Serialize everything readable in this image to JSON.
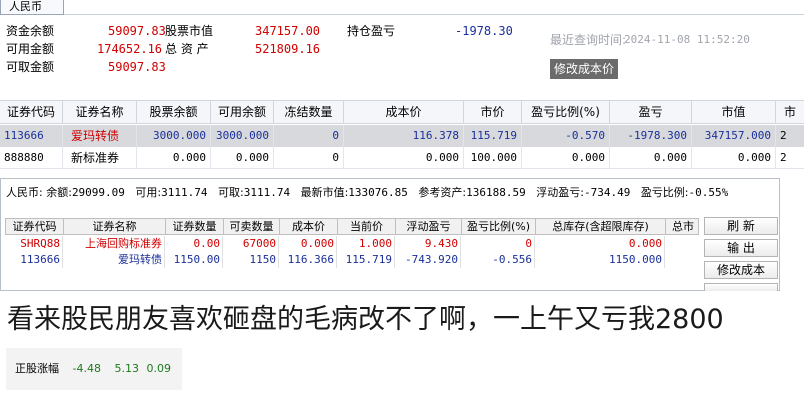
{
  "tab": {
    "label": "人民币"
  },
  "summary": {
    "cash_balance_label": "资金余额",
    "cash_balance": "59097.83",
    "available_label": "可用金额",
    "available": "174652.16",
    "withdrawable_label": "可取金额",
    "withdrawable": "59097.83",
    "stock_value_label": "股票市值",
    "stock_value": "347157.00",
    "total_assets_label": "总 资 产",
    "total_assets": "521809.16",
    "position_pl_label": "持仓盈亏",
    "position_pl": "-1978.30",
    "last_query_label": "最近查询时间:",
    "last_query_time": "2024-11-08 11:52:20",
    "modify_cost_button": "修改成本价"
  },
  "table1": {
    "headers": [
      "证券代码",
      "证券名称",
      "股票余额",
      "可用余额",
      "冻结数量",
      "成本价",
      "市价",
      "盈亏比例(%)",
      "盈亏",
      "市值",
      "市"
    ],
    "rows": [
      [
        "113666",
        "爱玛转债",
        "3000.000",
        "3000.000",
        "0",
        "116.378",
        "115.719",
        "-0.570",
        "-1978.300",
        "347157.000",
        "2"
      ],
      [
        "888880",
        "新标准券",
        "0.000",
        "0.000",
        "0",
        "0.000",
        "100.000",
        "0.000",
        "0.000",
        "0.000",
        "2"
      ]
    ]
  },
  "panel2": {
    "currency": "人民币:",
    "balance_label": "余额:",
    "balance": "29099.09",
    "available_label": "可用:",
    "available": "3111.74",
    "withdrawable_label": "可取:",
    "withdrawable": "3111.74",
    "latest_value_label": "最新市值:",
    "latest_value": "133076.85",
    "ref_assets_label": "参考资产:",
    "ref_assets": "136188.59",
    "float_pl_label": "浮动盈亏:",
    "float_pl": "-734.49",
    "pl_ratio_label": "盈亏比例:",
    "pl_ratio": "-0.55%",
    "headers": [
      "证券代码",
      "证券名称",
      "证券数量",
      "可卖数量",
      "成本价",
      "当前价",
      "浮动盈亏",
      "盈亏比例(%)",
      "总库存(含超限库存)",
      "总市"
    ],
    "rows": [
      [
        "SHRQ88",
        "上海回购标准券",
        "0.00",
        "67000",
        "0.000",
        "1.000",
        "9.430",
        "0",
        "0.000",
        ""
      ],
      [
        "113666",
        "爱玛转债",
        "1150.00",
        "1150",
        "116.366",
        "115.719",
        "-743.920",
        "-0.556",
        "1150.000",
        ""
      ]
    ],
    "buttons": [
      "刷 新",
      "输 出",
      "修改成本"
    ]
  },
  "caption": "看来股民朋友喜欢砸盘的毛病改不了啊，一上午又亏我2800",
  "rise_box": {
    "label": "正股涨幅",
    "v1": "-4.48",
    "v2": "5.13",
    "v3": "0.09"
  },
  "colors": {
    "pl_red": "#d00000",
    "pl_blue": "#1a2f9a",
    "pl_green": "#1d7a1d",
    "selected_row": "#d7d9dd"
  }
}
